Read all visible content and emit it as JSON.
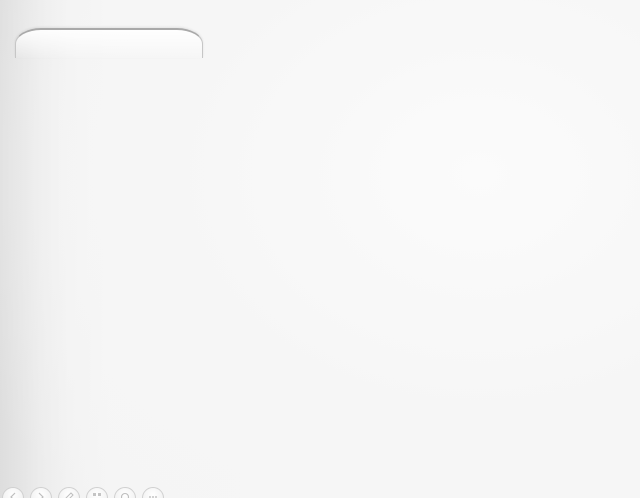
{
  "tab": {
    "label": ""
  },
  "toolbar": {
    "icons": [
      "back-icon",
      "forward-icon",
      "edit-icon",
      "grid-icon",
      "circle-icon",
      "more-icon"
    ]
  },
  "colors": {
    "background": "#f5f5f5",
    "tab_border": "#a9a9a9",
    "icon_border": "#d0d0d0"
  }
}
